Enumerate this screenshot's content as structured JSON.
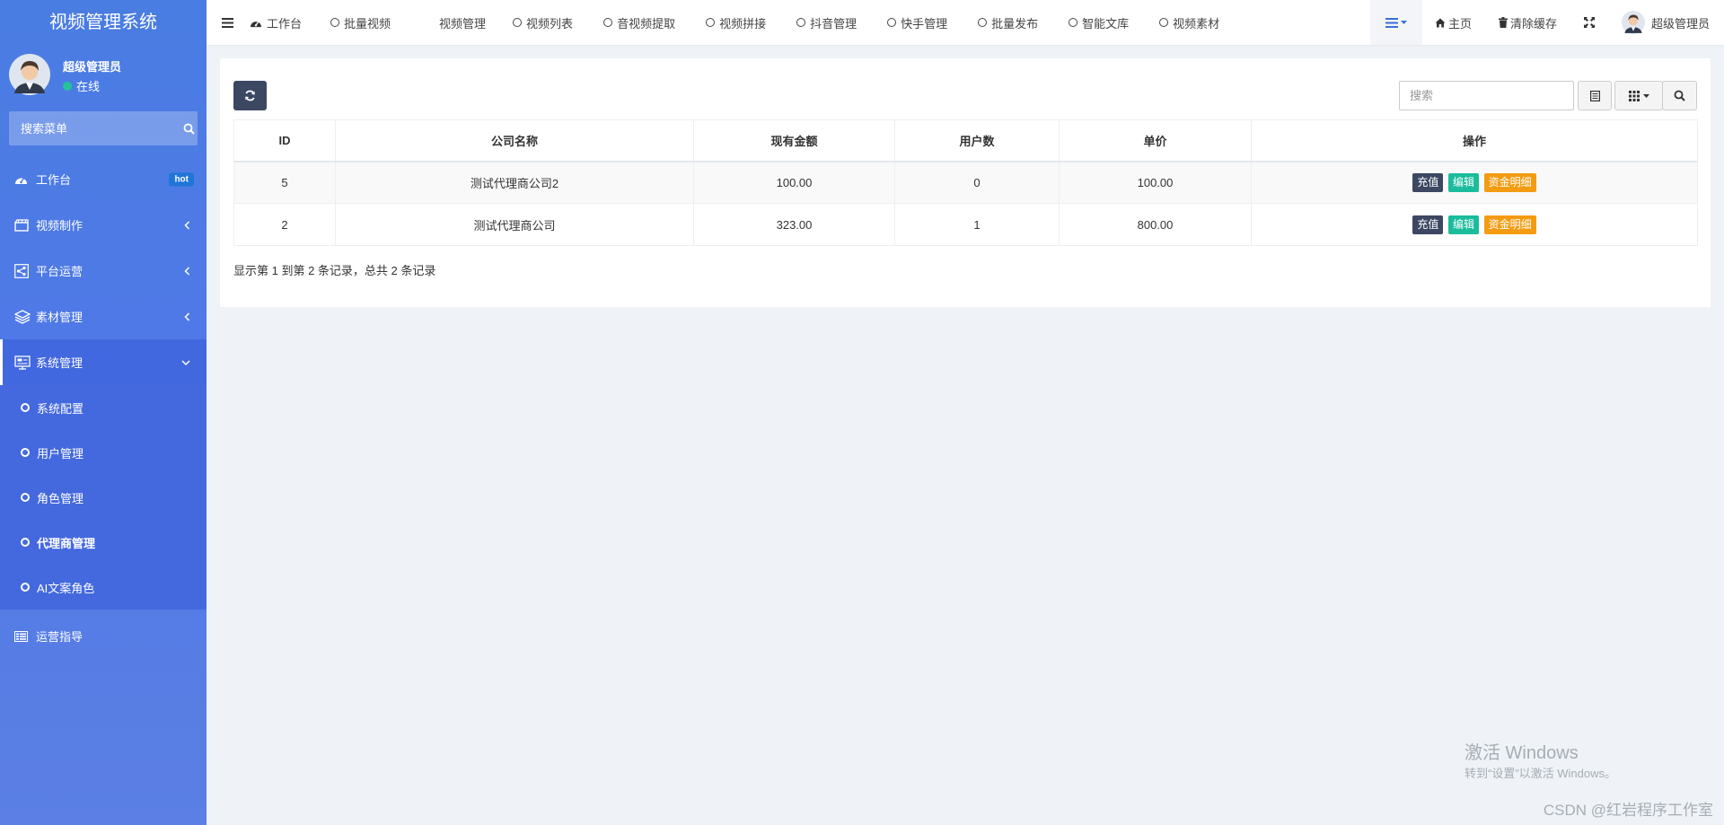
{
  "sidebar": {
    "app_title": "视频管理系统",
    "user_name": "超级管理员",
    "user_status": "在线",
    "search_placeholder": "搜索菜单",
    "menu": [
      {
        "label": "工作台",
        "badge": "hot",
        "icon": "dashboard-icon"
      },
      {
        "label": "视频制作",
        "icon": "film-icon"
      },
      {
        "label": "平台运营",
        "icon": "share-icon"
      },
      {
        "label": "素材管理",
        "icon": "layers-icon"
      },
      {
        "label": "系统管理",
        "icon": "monitor-icon",
        "active": true
      }
    ],
    "submenu": [
      {
        "label": "系统配置"
      },
      {
        "label": "用户管理"
      },
      {
        "label": "角色管理"
      },
      {
        "label": "代理商管理",
        "active": true
      },
      {
        "label": "AI文案角色"
      }
    ],
    "bottom_item": {
      "label": "运营指导",
      "icon": "list-icon"
    }
  },
  "topnav": {
    "tabs": [
      {
        "label": "工作台",
        "icon": "dashboard-icon"
      },
      {
        "label": "批量视频",
        "icon": "circle-icon"
      },
      {
        "label": "视频管理",
        "icon": ""
      },
      {
        "label": "视频列表",
        "icon": "circle-icon"
      },
      {
        "label": "音视频提取",
        "icon": "circle-icon"
      },
      {
        "label": "视频拼接",
        "icon": "circle-icon"
      },
      {
        "label": "抖音管理",
        "icon": "circle-icon"
      },
      {
        "label": "快手管理",
        "icon": "circle-icon"
      },
      {
        "label": "批量发布",
        "icon": "circle-icon"
      },
      {
        "label": "智能文库",
        "icon": "circle-icon"
      },
      {
        "label": "视频素材",
        "icon": "circle-icon"
      }
    ],
    "home_label": "主页",
    "clear_cache_label": "清除缓存",
    "user_name": "超级管理员"
  },
  "table": {
    "search_placeholder": "搜索",
    "columns": [
      "ID",
      "公司名称",
      "现有金额",
      "用户数",
      "单价",
      "操作"
    ],
    "rows": [
      {
        "id": "5",
        "company": "测试代理商公司2",
        "balance": "100.00",
        "users": "0",
        "price": "100.00"
      },
      {
        "id": "2",
        "company": "测试代理商公司",
        "balance": "323.00",
        "users": "1",
        "price": "800.00"
      }
    ],
    "actions": {
      "recharge": "充值",
      "edit": "编辑",
      "funds": "资金明细"
    },
    "pagination_info": "显示第 1 到第 2 条记录，总共 2 条记录"
  },
  "watermark": {
    "title": "激活 Windows",
    "subtitle": "转到“设置”以激活 Windows。",
    "csdn": "CSDN @红岩程序工作室"
  },
  "colors": {
    "sidebar_top": "#4a7de2",
    "sidebar_active": "#4268df",
    "refresh_btn": "#3c4762",
    "edit_btn": "#1abc9c",
    "funds_btn": "#f39c12",
    "hot_badge": "#1f76d8",
    "online": "#25c29a"
  }
}
